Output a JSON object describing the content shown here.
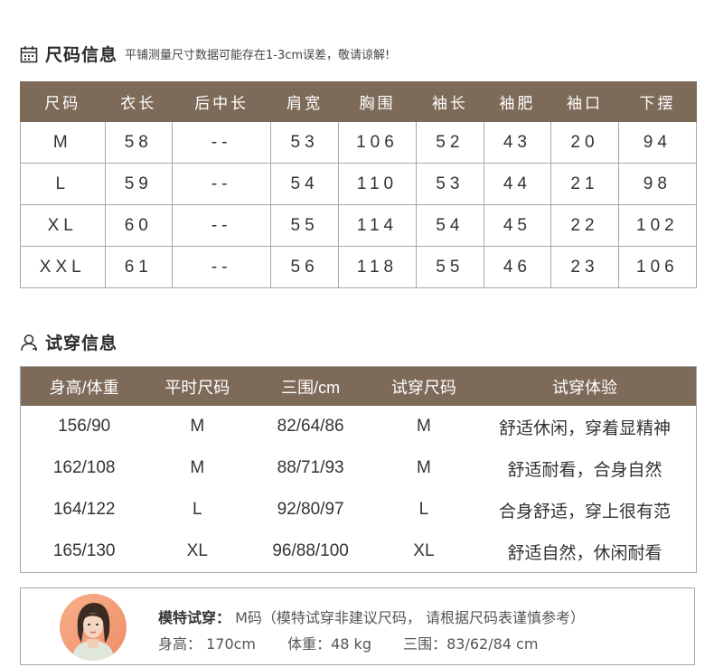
{
  "size_section": {
    "icon": "ruler-grid-icon",
    "title": "尺码信息",
    "note": "平铺测量尺寸数据可能存在1-3cm误差，敬请谅解!",
    "headers": [
      "尺码",
      "衣长",
      "后中长",
      "肩宽",
      "胸围",
      "袖长",
      "袖肥",
      "袖口",
      "下摆"
    ],
    "rows": [
      [
        "M",
        "58",
        "--",
        "53",
        "106",
        "52",
        "43",
        "20",
        "94"
      ],
      [
        "L",
        "59",
        "--",
        "54",
        "110",
        "53",
        "44",
        "21",
        "98"
      ],
      [
        "XL",
        "60",
        "--",
        "55",
        "114",
        "54",
        "45",
        "22",
        "102"
      ],
      [
        "XXL",
        "61",
        "--",
        "56",
        "118",
        "55",
        "46",
        "23",
        "106"
      ]
    ]
  },
  "fit_section": {
    "icon": "person-icon",
    "title": "试穿信息",
    "headers": [
      "身高/体重",
      "平时尺码",
      "三围/cm",
      "试穿尺码",
      "试穿体验"
    ],
    "rows": [
      [
        "156/90",
        "M",
        "82/64/86",
        "M",
        "舒适休闲，穿着显精神"
      ],
      [
        "162/108",
        "M",
        "88/71/93",
        "M",
        "舒适耐看，合身自然"
      ],
      [
        "164/122",
        "L",
        "92/80/97",
        "L",
        "合身舒适，穿上很有范"
      ],
      [
        "165/130",
        "XL",
        "96/88/100",
        "XL",
        "舒适自然，休闲耐看"
      ]
    ]
  },
  "model": {
    "label": "模特试穿：",
    "text": " M码（模特试穿非建议尺码， 请根据尺码表谨慎参考）",
    "height": "身高：  170cm",
    "weight": "体重：48 kg",
    "bust": "三围：83/62/84 cm"
  },
  "colors": {
    "header_bg": "#7e6a59",
    "border": "#a8a8a8"
  }
}
